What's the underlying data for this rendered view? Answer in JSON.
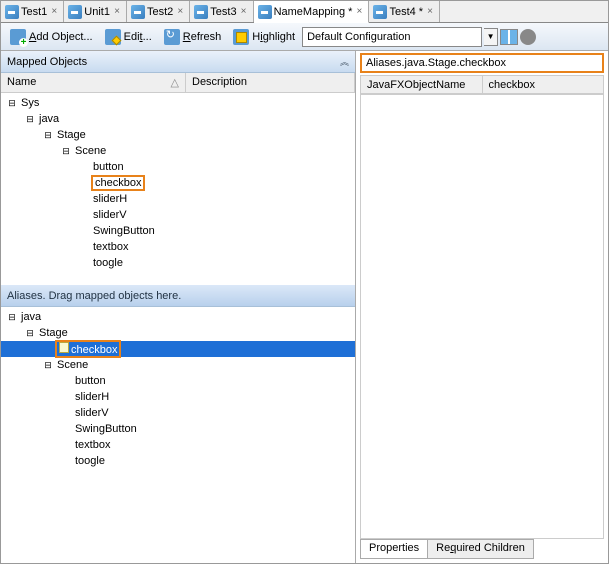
{
  "tabs": [
    {
      "label": "Test1",
      "dirty": false,
      "active": false
    },
    {
      "label": "Unit1",
      "dirty": false,
      "active": false
    },
    {
      "label": "Test2",
      "dirty": false,
      "active": false
    },
    {
      "label": "Test3",
      "dirty": false,
      "active": false
    },
    {
      "label": "NameMapping",
      "dirty": true,
      "active": true
    },
    {
      "label": "Test4",
      "dirty": true,
      "active": false
    }
  ],
  "toolbar": {
    "add": "Add Object...",
    "edit": "Edit...",
    "refresh": "Refresh",
    "highlight": "Highlight",
    "config": "Default Configuration"
  },
  "leftHeader": "Mapped Objects",
  "columns": {
    "name": "Name",
    "desc": "Description"
  },
  "mappedTree": [
    {
      "d": 0,
      "tw": "⊟",
      "lbl": "Sys"
    },
    {
      "d": 1,
      "tw": "⊟",
      "lbl": "java"
    },
    {
      "d": 2,
      "tw": "⊟",
      "lbl": "Stage"
    },
    {
      "d": 3,
      "tw": "⊟",
      "lbl": "Scene"
    },
    {
      "d": 4,
      "tw": "",
      "lbl": "button"
    },
    {
      "d": 4,
      "tw": "",
      "lbl": "checkbox",
      "hl": true
    },
    {
      "d": 4,
      "tw": "",
      "lbl": "sliderH"
    },
    {
      "d": 4,
      "tw": "",
      "lbl": "sliderV"
    },
    {
      "d": 4,
      "tw": "",
      "lbl": "SwingButton"
    },
    {
      "d": 4,
      "tw": "",
      "lbl": "textbox"
    },
    {
      "d": 4,
      "tw": "",
      "lbl": "toogle"
    }
  ],
  "aliasesHeader": "Aliases. Drag mapped objects here.",
  "aliasesTree": [
    {
      "d": 0,
      "tw": "⊟",
      "lbl": "java"
    },
    {
      "d": 1,
      "tw": "⊟",
      "lbl": "Stage"
    },
    {
      "d": 2,
      "tw": "",
      "lbl": "checkbox",
      "hl": true,
      "sel": true,
      "icon": true
    },
    {
      "d": 2,
      "tw": "⊟",
      "lbl": "Scene"
    },
    {
      "d": 3,
      "tw": "",
      "lbl": "button"
    },
    {
      "d": 3,
      "tw": "",
      "lbl": "sliderH"
    },
    {
      "d": 3,
      "tw": "",
      "lbl": "sliderV"
    },
    {
      "d": 3,
      "tw": "",
      "lbl": "SwingButton"
    },
    {
      "d": 3,
      "tw": "",
      "lbl": "textbox"
    },
    {
      "d": 3,
      "tw": "",
      "lbl": "toogle"
    }
  ],
  "pathField": "Aliases.java.Stage.checkbox",
  "props": {
    "col1": "JavaFXObjectName",
    "col2": "checkbox"
  },
  "bottomTabs": {
    "t1": "Properties",
    "t2": "Required Children"
  }
}
